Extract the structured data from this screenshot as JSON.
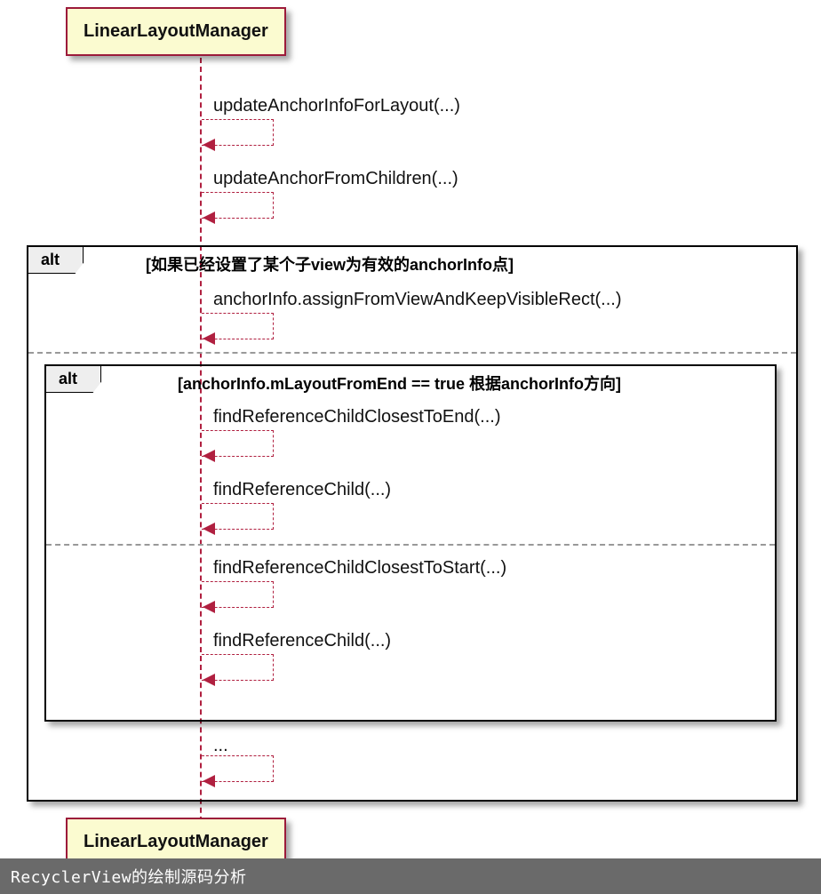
{
  "participant": {
    "name": "LinearLayoutManager"
  },
  "messages": {
    "m1": "updateAnchorInfoForLayout(...)",
    "m2": "updateAnchorFromChildren(...)",
    "m3": "anchorInfo.assignFromViewAndKeepVisibleRect(...)",
    "m4": "findReferenceChildClosestToEnd(...)",
    "m5": "findReferenceChild(...)",
    "m6": "findReferenceChildClosestToStart(...)",
    "m7": "findReferenceChild(...)",
    "m8": "..."
  },
  "fragments": {
    "outer": {
      "label": "alt",
      "guard": "[如果已经设置了某个子view为有效的anchorInfo点]"
    },
    "inner": {
      "label": "alt",
      "guard": "[anchorInfo.mLayoutFromEnd == true 根据anchorInfo方向]"
    }
  },
  "caption": "RecyclerView的绘制源码分析",
  "colors": {
    "line": "#b02040",
    "box": "#fbfbd0",
    "boxBorder": "#9c1a3a",
    "fragBg": "#eee"
  }
}
